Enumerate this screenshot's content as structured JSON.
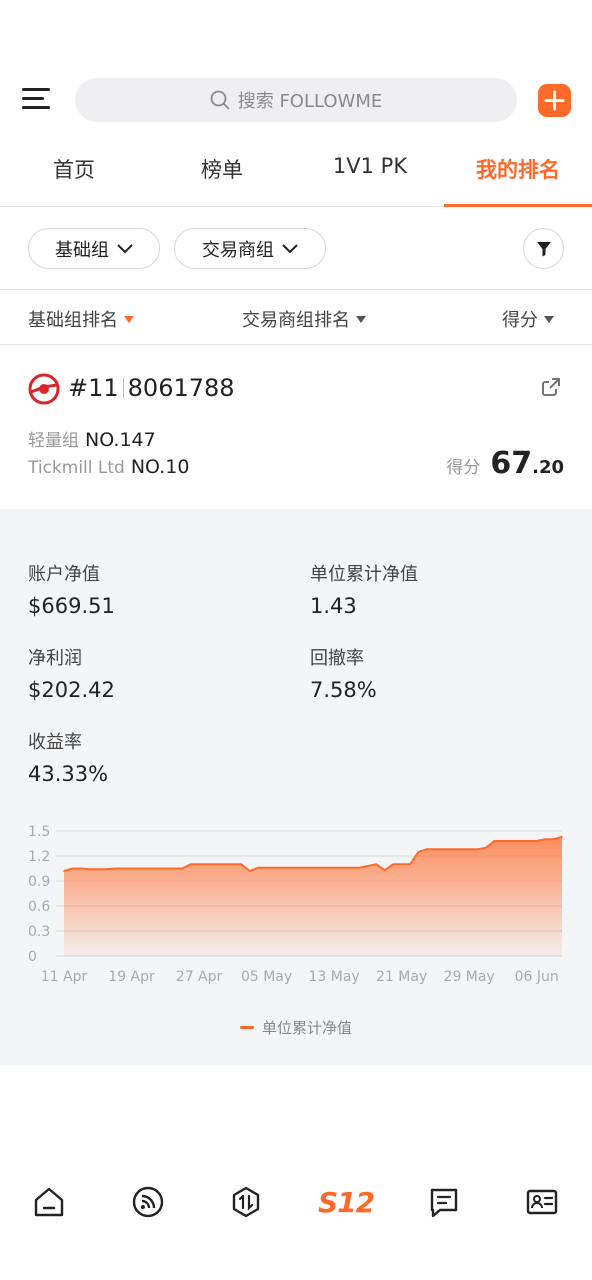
{
  "search": {
    "label": "搜索 FOLLOWME"
  },
  "tabs": [
    {
      "label": "首页"
    },
    {
      "label": "榜单"
    },
    {
      "label": "1V1 PK"
    },
    {
      "label": "我的排名"
    }
  ],
  "filters": {
    "group": "基础组",
    "broker_group": "交易商组"
  },
  "sort": {
    "col1": "基础组排名",
    "col2": "交易商组排名",
    "col3": "得分"
  },
  "account": {
    "rank": "#11",
    "id": "8061788",
    "group_label": "轻量组",
    "group_rank": "NO.147",
    "broker_label": "Tickmill Ltd",
    "broker_rank": "NO.10",
    "score_label": "得分",
    "score_int": "67",
    "score_dec": ".20"
  },
  "stats": {
    "equity_label": "账户净值",
    "equity_value": "$669.51",
    "nav_label": "单位累计净值",
    "nav_value": "1.43",
    "profit_label": "净利润",
    "profit_value": "$202.42",
    "drawdown_label": "回撤率",
    "drawdown_value": "7.58%",
    "return_label": "收益率",
    "return_value": "43.33%"
  },
  "chart_data": {
    "type": "area",
    "x": [
      "11 Apr",
      "12 Apr",
      "13 Apr",
      "14 Apr",
      "15 Apr",
      "16 Apr",
      "17 Apr",
      "18 Apr",
      "19 Apr",
      "20 Apr",
      "21 Apr",
      "22 Apr",
      "23 Apr",
      "24 Apr",
      "25 Apr",
      "26 Apr",
      "27 Apr",
      "28 Apr",
      "29 Apr",
      "30 Apr",
      "01 May",
      "02 May",
      "03 May",
      "04 May",
      "05 May",
      "06 May",
      "07 May",
      "08 May",
      "09 May",
      "10 May",
      "11 May",
      "12 May",
      "13 May",
      "14 May",
      "15 May",
      "16 May",
      "17 May",
      "18 May",
      "19 May",
      "20 May",
      "21 May",
      "22 May",
      "23 May",
      "24 May",
      "25 May",
      "26 May",
      "27 May",
      "28 May",
      "29 May",
      "30 May",
      "31 May",
      "01 Jun",
      "02 Jun",
      "03 Jun",
      "04 Jun",
      "05 Jun",
      "06 Jun",
      "07 Jun",
      "08 Jun",
      "09 Jun"
    ],
    "series": [
      {
        "name": "单位累计净值",
        "values": [
          1.02,
          1.05,
          1.05,
          1.04,
          1.04,
          1.04,
          1.05,
          1.05,
          1.05,
          1.05,
          1.05,
          1.05,
          1.05,
          1.05,
          1.05,
          1.1,
          1.1,
          1.1,
          1.1,
          1.1,
          1.1,
          1.1,
          1.02,
          1.06,
          1.06,
          1.06,
          1.06,
          1.06,
          1.06,
          1.06,
          1.06,
          1.06,
          1.06,
          1.06,
          1.06,
          1.06,
          1.08,
          1.1,
          1.03,
          1.1,
          1.1,
          1.1,
          1.25,
          1.28,
          1.28,
          1.28,
          1.28,
          1.28,
          1.28,
          1.28,
          1.3,
          1.38,
          1.38,
          1.38,
          1.38,
          1.38,
          1.38,
          1.4,
          1.4,
          1.43
        ]
      }
    ],
    "xticks": [
      "11 Apr",
      "19 Apr",
      "27 Apr",
      "05 May",
      "13 May",
      "21 May",
      "29 May",
      "06 Jun"
    ],
    "yticks": [
      "0",
      "0.3",
      "0.6",
      "0.9",
      "1.2",
      "1.5"
    ],
    "ylim": [
      0,
      1.5
    ],
    "grid": true,
    "legend": "bottom-center",
    "color": "#ff6a2a"
  },
  "nav": [
    {
      "icon": "home-icon"
    },
    {
      "icon": "feed-icon"
    },
    {
      "icon": "trade-icon"
    },
    {
      "icon": "s12-icon",
      "label": "S12"
    },
    {
      "icon": "message-icon"
    },
    {
      "icon": "profile-card-icon"
    }
  ]
}
